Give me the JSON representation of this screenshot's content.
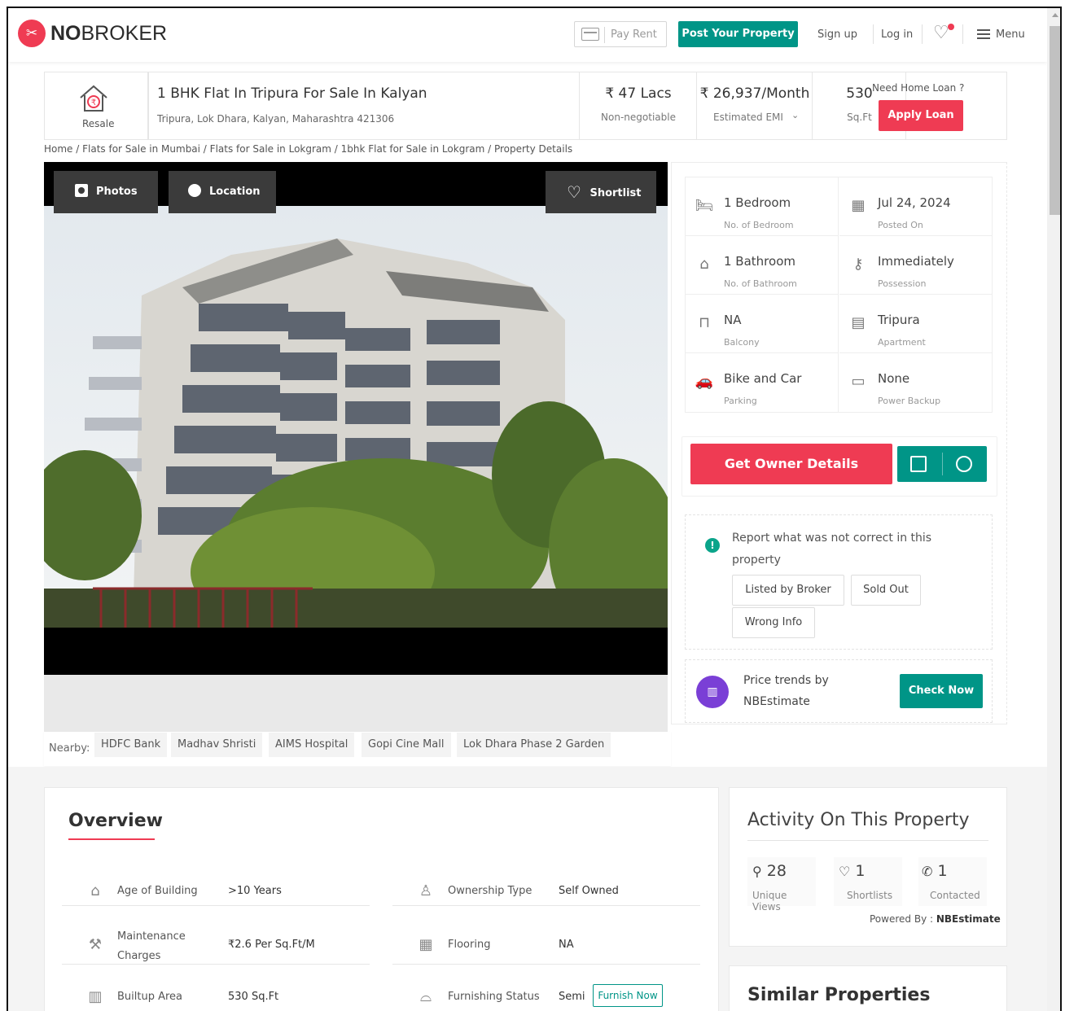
{
  "header": {
    "logo_bold": "NO",
    "logo_rest": "BROKER",
    "pay_rent": "Pay Rent",
    "post_property": "Post Your Property",
    "sign_up": "Sign up",
    "log_in": "Log in",
    "menu": "Menu"
  },
  "listing": {
    "type_badge": "Resale",
    "title": "1 BHK Flat In Tripura For Sale In Kalyan",
    "address": "Tripura, Lok Dhara, Kalyan, Maharashtra 421306",
    "price": "₹ 47 Lacs",
    "price_note": "Non-negotiable",
    "emi": "₹ 26,937/Month",
    "emi_note": "Estimated EMI",
    "area": "530",
    "area_unit": "Sq.Ft",
    "loan_prompt": "Need Home Loan ?",
    "apply_loan": "Apply Loan"
  },
  "breadcrumb": "Home / Flats for Sale in Mumbai / Flats for Sale in Lokgram / 1bhk Flat for Sale in Lokgram / Property Details",
  "gallery": {
    "photos": "Photos",
    "location": "Location",
    "shortlist": "Shortlist"
  },
  "specs": [
    {
      "value": "1 Bedroom",
      "label": "No. of Bedroom",
      "icon": "bed-icon"
    },
    {
      "value": "Jul 24, 2024",
      "label": "Posted On",
      "icon": "calendar-icon"
    },
    {
      "value": "1 Bathroom",
      "label": "No. of Bathroom",
      "icon": "bathtub-icon"
    },
    {
      "value": "Immediately",
      "label": "Possession",
      "icon": "key-icon"
    },
    {
      "value": "NA",
      "label": "Balcony",
      "icon": "balcony-icon"
    },
    {
      "value": "Tripura",
      "label": "Apartment",
      "icon": "building-icon"
    },
    {
      "value": "Bike and Car",
      "label": "Parking",
      "icon": "car-icon"
    },
    {
      "value": "None",
      "label": "Power Backup",
      "icon": "battery-icon"
    }
  ],
  "cta": {
    "owner_details": "Get Owner Details"
  },
  "report": {
    "text": "Report what was not correct in this property",
    "options": [
      "Listed by Broker",
      "Sold Out",
      "Wrong Info"
    ]
  },
  "price_trends": {
    "text_line1": "Price trends by",
    "text_line2": "NBEstimate",
    "button": "Check Now"
  },
  "nearby": {
    "label": "Nearby:",
    "places": [
      "HDFC Bank",
      "Madhav Shristi",
      "AIMS Hospital",
      "Gopi Cine Mall",
      "Lok Dhara Phase 2 Garden"
    ]
  },
  "overview": {
    "title": "Overview",
    "rows": [
      {
        "label": "Age of Building",
        "value": ">10 Years",
        "icon": "cake-icon"
      },
      {
        "label": "Ownership Type",
        "value": "Self Owned",
        "icon": "ownership-icon"
      },
      {
        "label": "Maintenance Charges",
        "value": "₹2.6 Per Sq.Ft/M",
        "icon": "tools-icon"
      },
      {
        "label": "Flooring",
        "value": "NA",
        "icon": "flooring-icon"
      },
      {
        "label": "Builtup Area",
        "value": "530 Sq.Ft",
        "icon": "area-icon"
      },
      {
        "label": "Furnishing Status",
        "value": "Semi",
        "icon": "sofa-icon"
      }
    ],
    "furnish_now": "Furnish Now"
  },
  "activity": {
    "title": "Activity On This Property",
    "stats": [
      {
        "value": "28",
        "label": "Unique Views",
        "icon": "user-icon"
      },
      {
        "value": "1",
        "label": "Shortlists",
        "icon": "heart-icon"
      },
      {
        "value": "1",
        "label": "Contacted",
        "icon": "phone-icon"
      }
    ],
    "powered_by_label": "Powered By :",
    "powered_by": "NBEstimate"
  },
  "similar": {
    "title": "Similar Properties"
  }
}
